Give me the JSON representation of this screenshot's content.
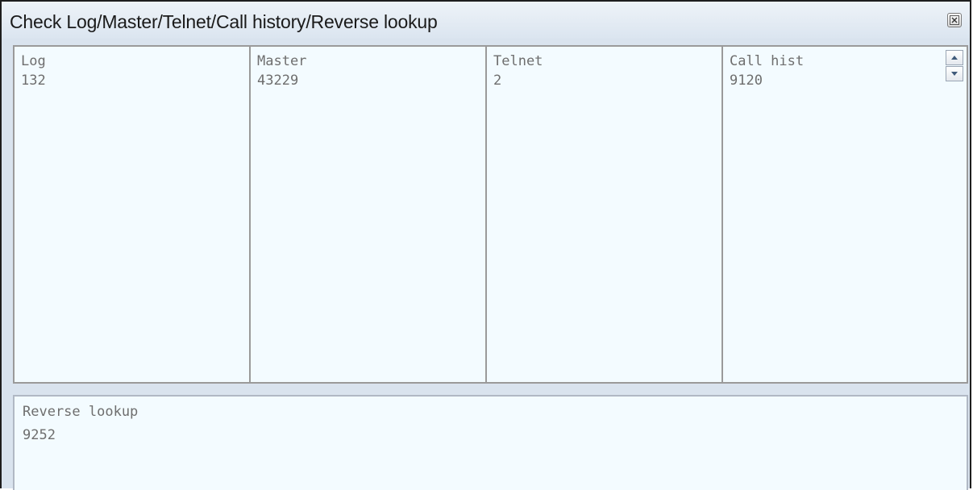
{
  "window": {
    "title": "Check Log/Master/Telnet/Call history/Reverse lookup"
  },
  "panes": [
    {
      "label": "Log",
      "value": "132"
    },
    {
      "label": "Master",
      "value": "43229"
    },
    {
      "label": "Telnet",
      "value": "2"
    },
    {
      "label": "Call hist",
      "value": "9120"
    }
  ],
  "reverse_lookup": {
    "label": "Reverse lookup",
    "value": "9252"
  },
  "icons": {
    "close": "close-icon",
    "scroll_up": "arrow-up-icon",
    "scroll_down": "arrow-down-icon"
  },
  "colors": {
    "pane_background": "#f3fbff",
    "text": "#6e6e6e",
    "title_text": "#1a1a1a"
  }
}
